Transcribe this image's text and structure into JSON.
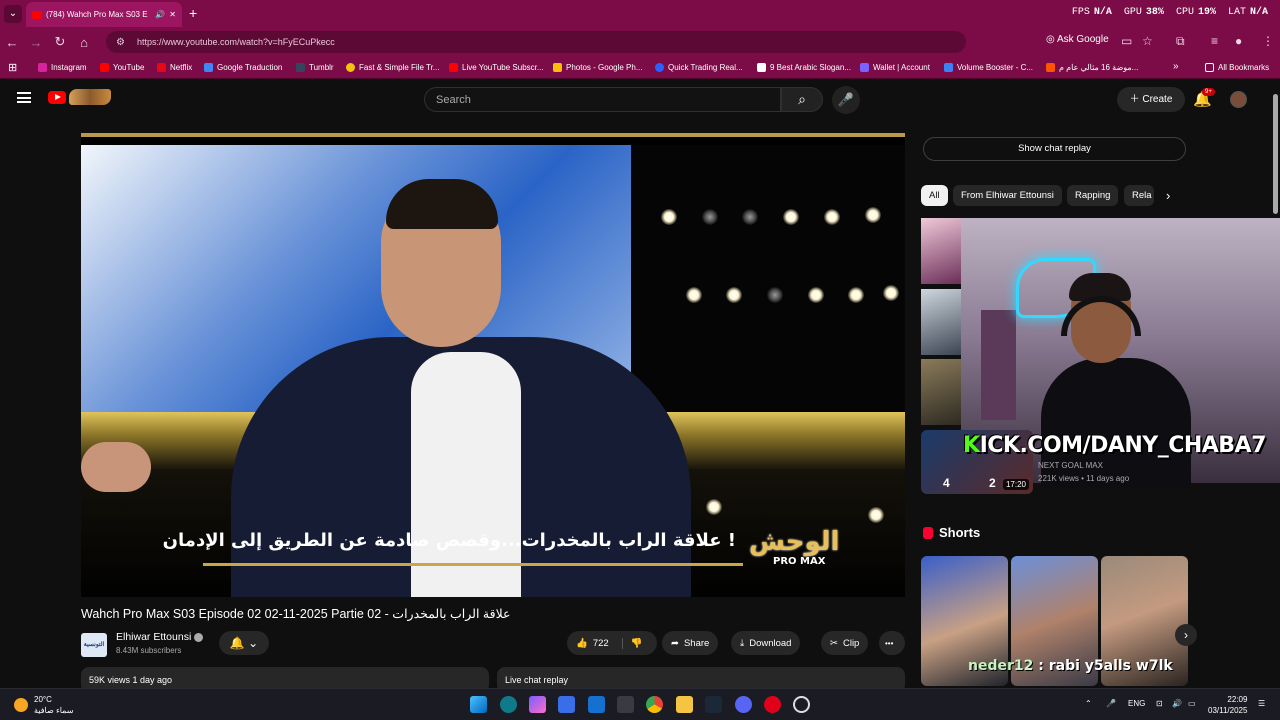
{
  "browser": {
    "tab_title": "(784) Wahch Pro Max S03 E",
    "new_tab": "+",
    "url": "https://www.youtube.com/watch?v=hFyECuPkecc",
    "ask_google": "Ask Google",
    "perf": {
      "fps_label": "FPS",
      "fps_value": "N/A",
      "gpu_label": "GPU",
      "gpu_value": "38%",
      "cpu_label": "CPU",
      "cpu_value": "19%",
      "lat_label": "LAT",
      "lat_value": "N/A"
    },
    "bookmarks": [
      {
        "label": "Instagram",
        "color": "#d6249f"
      },
      {
        "label": "YouTube",
        "color": "#ff0000"
      },
      {
        "label": "Netflix",
        "color": "#e50914"
      },
      {
        "label": "Google Traduction",
        "color": "#4285f4"
      },
      {
        "label": "Tumblr",
        "color": "#35465c"
      },
      {
        "label": "Fast & Simple File Tr...",
        "color": "#f4c20d"
      },
      {
        "label": "Live YouTube Subscr...",
        "color": "#ff0000"
      },
      {
        "label": "Photos - Google Ph...",
        "color": "#fbbc05"
      },
      {
        "label": "Quick Trading Real...",
        "color": "#2962ff"
      },
      {
        "label": "9 Best Arabic Slogan...",
        "color": "#222222"
      },
      {
        "label": "Wallet | Account",
        "color": "#7b61ff"
      },
      {
        "label": "Volume Booster - C...",
        "color": "#3b82f6"
      },
      {
        "label": "موضة 16 مثالي عام م...",
        "color": "#ff5500"
      }
    ],
    "all_bookmarks": "All Bookmarks"
  },
  "youtube": {
    "search_placeholder": "Search",
    "create_label": "Create",
    "notif_badge": "9+",
    "video": {
      "subtitle": "علاقة الراب بالمخدرات...وقصص صادمة عن الطريق إلى الإدمان !",
      "show_logo": "الوحش",
      "show_logo_sub": "PRO MAX",
      "title": "Wahch Pro Max S03 Episode 02 02-11-2025 Partie 02 - علاقة الراب بالمخدرات",
      "channel_name": "Elhiwar Ettounsi",
      "channel_avatar_text": "التونسية",
      "subscribers": "8.43M subscribers",
      "likes": "722",
      "share": "Share",
      "download": "Download",
      "clip": "Clip",
      "more": "•••",
      "views_date": "59K views  1 day ago",
      "live_chat_replay": "Live chat replay"
    },
    "sidebar": {
      "show_chat_replay": "Show chat replay",
      "chips": [
        "All",
        "From Elhiwar Ettounsi",
        "Rapping",
        "Rela"
      ],
      "overlay_url": "ICK.COM/DANY_CHABA7",
      "overlay_k": "K",
      "next_video_channel": "NEXT GOAL MAX",
      "next_video_meta": "221K views • 11 days ago",
      "next_video_score_a": "4",
      "next_video_score_b": "2",
      "next_video_duration": "17:20",
      "shorts_title": "Shorts",
      "chat_overlay_user": "neder12",
      "chat_overlay_msg": ": rabi y5alls w7lk"
    }
  },
  "taskbar": {
    "weather_temp": "20°C",
    "weather_desc": "سماء صافية",
    "lang": "ENG",
    "time": "22:09",
    "date": "03/11/2025"
  }
}
